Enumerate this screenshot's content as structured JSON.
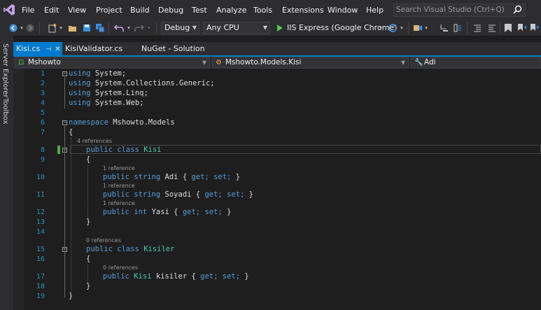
{
  "menu": [
    "File",
    "Edit",
    "View",
    "Project",
    "Build",
    "Debug",
    "Test",
    "Analyze",
    "Tools",
    "Extensions",
    "Window",
    "Help"
  ],
  "search": {
    "placeholder": "Search Visual Studio (Ctrl+Q)"
  },
  "toolbar": {
    "configuration": "Debug",
    "platform": "Any CPU",
    "run_label": "IIS Express (Google Chrome)"
  },
  "side_tabs": [
    "Server Explorer",
    "Toolbox"
  ],
  "tabs": [
    {
      "label": "Kisi.cs",
      "active": true
    },
    {
      "label": "KisiValidator.cs",
      "active": false
    },
    {
      "label": "NuGet - Solution",
      "active": false
    }
  ],
  "navbar": {
    "project": "Mshowto",
    "class": "Mshowto.Models.Kisi",
    "member": "Adi"
  },
  "line_numbers": [
    "1",
    "2",
    "3",
    "4",
    "5",
    "6",
    "7",
    "8",
    "9",
    "10",
    "11",
    "12",
    "13",
    "14",
    "15",
    "16",
    "17",
    "18",
    "19"
  ],
  "code": {
    "l1_kw": "using",
    "l1_rest": " System;",
    "l2_kw": "using",
    "l2_rest": " System.Collections.Generic;",
    "l3_kw": "using",
    "l3_rest": " System.Linq;",
    "l4_kw": "using",
    "l4_rest": " System.Web;",
    "l6_kw": "namespace",
    "l6_rest": " Mshowto.Models",
    "open_brace": "{",
    "close_brace": "}",
    "ref_4": "4 references",
    "ref_1": "1 reference",
    "ref_0": "0 references",
    "public": "public",
    "class": "class",
    "string": "string",
    "int": "int",
    "get": "get;",
    "set": "set;",
    "kisi_class": "Kisi",
    "kisiler_class": "Kisiler",
    "adi": "Adi",
    "soyadi": "Soyadi",
    "yasi": "Yasi",
    "kisiler_prop": "kisiler"
  }
}
